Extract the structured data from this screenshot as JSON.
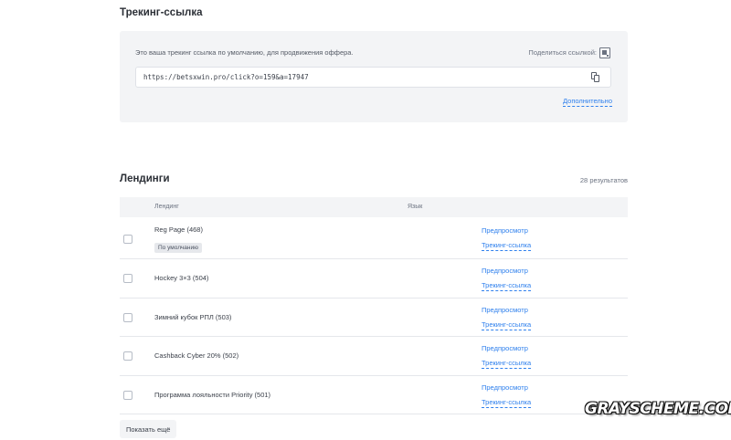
{
  "tracking": {
    "title": "Трекинг-ссылка",
    "description": "Это ваша трекинг ссылка по умолчанию, для продвижения оффера.",
    "share_label": "Поделиться ссылкой:",
    "link_value": "https://betsxwin.pro/click?o=159&a=17947",
    "more_label": "Дополнительно"
  },
  "landings": {
    "title": "Лендинги",
    "results": "28  результатов",
    "columns": {
      "landing": "Лендинг",
      "language": "Язык"
    },
    "rows": [
      {
        "name": "Reg Page (468)",
        "badge": "По умолчанию",
        "preview": "Предпросмотр",
        "tracking": "Трекинг-ссылка"
      },
      {
        "name": "Hockey 3×3 (504)",
        "preview": "Предпросмотр",
        "tracking": "Трекинг-ссылка"
      },
      {
        "name": "Зимний кубок РПЛ (503)",
        "preview": "Предпросмотр",
        "tracking": "Трекинг-ссылка"
      },
      {
        "name": "Cashback Cyber 20% (502)",
        "preview": "Предпросмотр",
        "tracking": "Трекинг-ссылка"
      },
      {
        "name": "Программа лояльности Priority (501)",
        "preview": "Предпросмотр",
        "tracking": "Трекинг-ссылка"
      }
    ],
    "show_more": "Показать ещё"
  },
  "watermark": "GRAYSCHEME.COM",
  "colors": {
    "accent": "#2f80ed",
    "panel_bg": "#f3f4f6",
    "text": "#2b2f36"
  },
  "icons": {
    "share": "qr-code-icon",
    "copy": "copy-icon"
  }
}
